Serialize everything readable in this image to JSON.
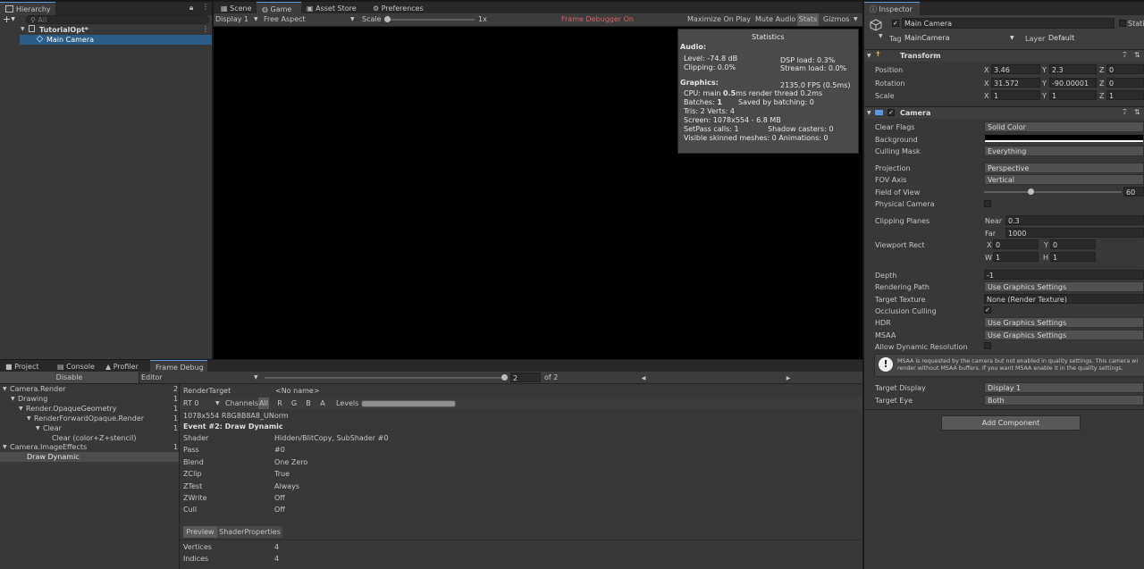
{
  "hierarchy": {
    "tab_label": "Hierarchy",
    "search_placeholder": "All",
    "items": [
      {
        "label": "TutorialOpt*"
      },
      {
        "label": "Main Camera"
      }
    ]
  },
  "game": {
    "tabs": [
      {
        "label": "Scene"
      },
      {
        "label": "Game"
      },
      {
        "label": "Asset Store"
      },
      {
        "label": "Preferences"
      }
    ],
    "display": "Display 1",
    "aspect": "Free Aspect",
    "scale_label": "Scale",
    "scale_value": "1x",
    "frame_debugger_label": "Frame Debugger On",
    "maximize_label": "Maximize On Play",
    "mute_label": "Mute Audio",
    "stats_label": "Stats",
    "gizmos_label": "Gizmos"
  },
  "statistics": {
    "title": "Statistics",
    "audio_header": "Audio:",
    "level": "Level: -74.8 dB",
    "clipping": "Clipping: 0.0%",
    "dsp": "DSP load: 0.3%",
    "stream": "Stream load: 0.0%",
    "graphics_header": "Graphics:",
    "fps": "2135.0 FPS (0.5ms)",
    "cpu_prefix": "CPU: main ",
    "cpu_main": "0.5",
    "cpu_suffix": "ms  render thread 0.2ms",
    "batches_prefix": "Batches: ",
    "batches_value": "1",
    "saved_batching": "Saved by batching: 0",
    "tris_verts": "Tris: 2   Verts: 4",
    "screen": "Screen: 1078x554 - 6.8 MB",
    "setpass": "SetPass calls: 1",
    "shadow": "Shadow casters: 0",
    "skinned": "Visible skinned meshes: 0  Animations: 0"
  },
  "bottom": {
    "tabs": [
      {
        "label": "Project"
      },
      {
        "label": "Console"
      },
      {
        "label": "Profiler"
      },
      {
        "label": "Frame Debug"
      }
    ],
    "disable_label": "Disable",
    "editor_label": "Editor",
    "event_index": "2",
    "event_total": "of 2",
    "event_slider_fraction": 1.0,
    "tree": [
      {
        "label": "Camera.Render",
        "count": "2"
      },
      {
        "label": "Drawing",
        "count": "1"
      },
      {
        "label": "Render.OpaqueGeometry",
        "count": "1"
      },
      {
        "label": "RenderForwardOpaque.Render",
        "count": "1"
      },
      {
        "label": "Clear",
        "count": "1"
      },
      {
        "label": "Clear (color+Z+stencil)",
        "count": ""
      },
      {
        "label": "Camera.ImageEffects",
        "count": "1"
      },
      {
        "label": "Draw Dynamic",
        "count": ""
      }
    ],
    "render_target_label": "RenderTarget",
    "render_target_value": "<No name>",
    "rt_select": "RT 0",
    "channels_label": "Channels",
    "channels": [
      "All",
      "R",
      "G",
      "B",
      "A"
    ],
    "levels_label": "Levels",
    "format": "1078x554 R8G8B8A8_UNorm",
    "event_title": "Event #2: Draw Dynamic",
    "props": [
      {
        "key": "Shader",
        "value": "Hidden/BlitCopy, SubShader #0"
      },
      {
        "key": "Pass",
        "value": "#0"
      },
      {
        "key": "Blend",
        "value": "One Zero"
      },
      {
        "key": "ZClip",
        "value": "True"
      },
      {
        "key": "ZTest",
        "value": "Always"
      },
      {
        "key": "ZWrite",
        "value": "Off"
      },
      {
        "key": "Cull",
        "value": "Off"
      }
    ],
    "preview_tab": "Preview",
    "shader_props_tab": "ShaderProperties",
    "vertices_label": "Vertices",
    "vertices_value": "4",
    "indices_label": "Indices",
    "indices_value": "4"
  },
  "inspector": {
    "tab_label": "Inspector",
    "object_name": "Main Camera",
    "static_label": "Static",
    "tag_label": "Tag",
    "tag_value": "MainCamera",
    "layer_label": "Layer",
    "layer_value": "Default",
    "transform": {
      "title": "Transform",
      "position_label": "Position",
      "rotation_label": "Rotation",
      "scale_label": "Scale",
      "position": {
        "x": "3.46",
        "y": "2.3",
        "z": "0"
      },
      "rotation": {
        "x": "31.572",
        "y": "-90.00001",
        "z": "0"
      },
      "scale": {
        "x": "1",
        "y": "1",
        "z": "1"
      }
    },
    "camera": {
      "title": "Camera",
      "clear_flags_label": "Clear Flags",
      "clear_flags_value": "Solid Color",
      "background_label": "Background",
      "culling_mask_label": "Culling Mask",
      "culling_mask_value": "Everything",
      "projection_label": "Projection",
      "projection_value": "Perspective",
      "fov_axis_label": "FOV Axis",
      "fov_axis_value": "Vertical",
      "fov_label": "Field of View",
      "fov_value": "60",
      "fov_fraction": 0.33,
      "physical_label": "Physical Camera",
      "clipping_label": "Clipping Planes",
      "near_label": "Near",
      "near_value": "0.3",
      "far_label": "Far",
      "far_value": "1000",
      "viewport_label": "Viewport Rect",
      "vp_x": "0",
      "vp_y": "0",
      "vp_w": "1",
      "vp_h": "1",
      "depth_label": "Depth",
      "depth_value": "-1",
      "rendering_path_label": "Rendering Path",
      "rendering_path_value": "Use Graphics Settings",
      "target_texture_label": "Target Texture",
      "target_texture_value": "None (Render Texture)",
      "occlusion_label": "Occlusion Culling",
      "hdr_label": "HDR",
      "hdr_value": "Use Graphics Settings",
      "msaa_label": "MSAA",
      "msaa_value": "Use Graphics Settings",
      "dynres_label": "Allow Dynamic Resolution",
      "warning_line1": "MSAA is requested by the camera but not enabled in quality settings. This camera wi",
      "warning_line2": "render without MSAA buffers. If you want MSAA enable it in the quality settings.",
      "target_display_label": "Target Display",
      "target_display_value": "Display 1",
      "target_eye_label": "Target Eye",
      "target_eye_value": "Both"
    },
    "add_component_label": "Add Component"
  },
  "colors": {
    "selection": "#2c5d87",
    "accent": "#5b9ae0",
    "frame_debugger_text": "#d66060",
    "panel_bg": "#383838",
    "game_view": "#000000"
  }
}
